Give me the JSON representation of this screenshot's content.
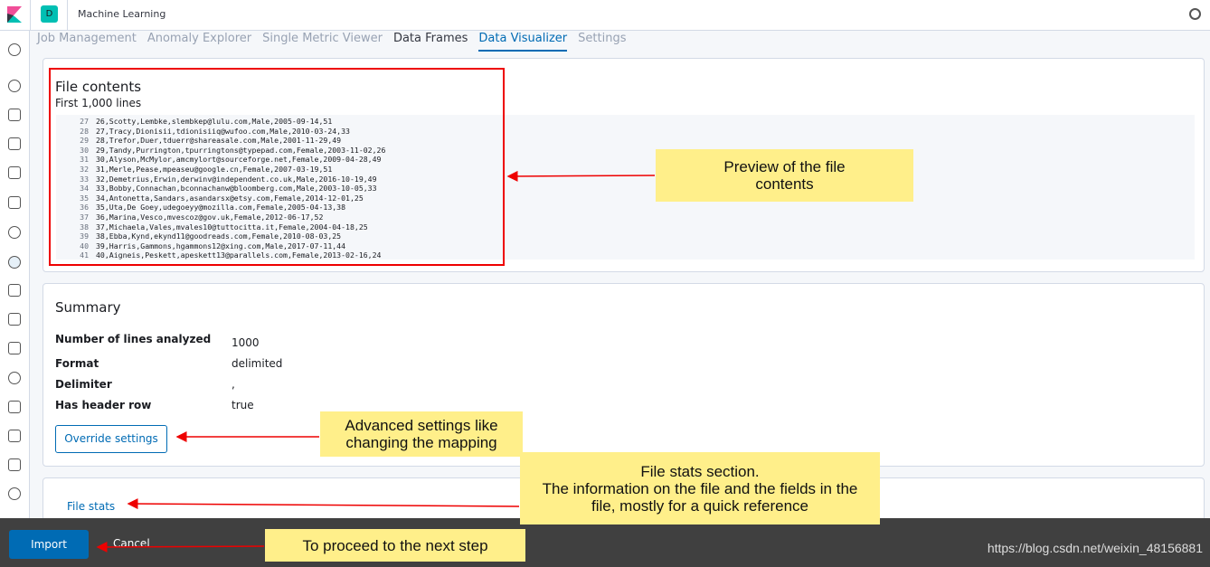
{
  "header": {
    "space_initial": "D",
    "app_title": "Machine Learning"
  },
  "tabs": [
    {
      "label": "Job Management"
    },
    {
      "label": "Anomaly Explorer"
    },
    {
      "label": "Single Metric Viewer"
    },
    {
      "label": "Data Frames"
    },
    {
      "label": "Data Visualizer"
    },
    {
      "label": "Settings"
    }
  ],
  "file_contents": {
    "title": "File contents",
    "subtitle": "First 1,000 lines",
    "lines": [
      {
        "n": "27",
        "t": "26,Scotty,Lembke,slembkep@lulu.com,Male,2005-09-14,51"
      },
      {
        "n": "28",
        "t": "27,Tracy,Dionisii,tdionisiiq@wufoo.com,Male,2010-03-24,33"
      },
      {
        "n": "29",
        "t": "28,Trefor,Duer,tduerr@shareasale.com,Male,2001-11-29,49"
      },
      {
        "n": "30",
        "t": "29,Tandy,Purrington,tpurringtons@typepad.com,Female,2003-11-02,26"
      },
      {
        "n": "31",
        "t": "30,Alyson,McMylor,amcmylort@sourceforge.net,Female,2009-04-28,49"
      },
      {
        "n": "32",
        "t": "31,Merle,Pease,mpeaseu@google.cn,Female,2007-03-19,51"
      },
      {
        "n": "33",
        "t": "32,Demetrius,Erwin,derwinv@independent.co.uk,Male,2016-10-19,49"
      },
      {
        "n": "34",
        "t": "33,Bobby,Connachan,bconnachanw@bloomberg.com,Male,2003-10-05,33"
      },
      {
        "n": "35",
        "t": "34,Antonetta,Sandars,asandarsx@etsy.com,Female,2014-12-01,25"
      },
      {
        "n": "36",
        "t": "35,Uta,De Goey,udegoeyy@mozilla.com,Female,2005-04-13,38"
      },
      {
        "n": "37",
        "t": "36,Marina,Vesco,mvescoz@gov.uk,Female,2012-06-17,52"
      },
      {
        "n": "38",
        "t": "37,Michaela,Vales,mvales10@tuttocitta.it,Female,2004-04-18,25"
      },
      {
        "n": "39",
        "t": "38,Ebba,Kynd,ekynd11@goodreads.com,Female,2010-08-03,25"
      },
      {
        "n": "40",
        "t": "39,Harris,Gammons,hgammons12@xing.com,Male,2017-07-11,44"
      },
      {
        "n": "41",
        "t": "40,Aigneis,Peskett,apeskett13@parallels.com,Female,2013-02-16,24"
      }
    ]
  },
  "summary": {
    "title": "Summary",
    "rows": [
      {
        "k": "Number of lines analyzed",
        "v": "1000"
      },
      {
        "k": "Format",
        "v": "delimited"
      },
      {
        "k": "Delimiter",
        "v": ","
      },
      {
        "k": "Has header row",
        "v": "true"
      }
    ],
    "override_label": "Override settings"
  },
  "file_stats": {
    "label": "File stats"
  },
  "footer": {
    "import_label": "Import",
    "cancel_label": "Cancel"
  },
  "annotations": {
    "preview": "Preview of the file contents",
    "advanced": "Advanced settings like changing the mapping",
    "stats": "File stats section.\nThe information on the file and the fields in the file, mostly for a quick reference",
    "proceed": "To proceed to the next step"
  },
  "watermark": "https://blog.csdn.net/weixin_48156881",
  "colors": {
    "accent": "#006bb4",
    "annotation": "#ffef8a",
    "arrow": "#e00000"
  }
}
